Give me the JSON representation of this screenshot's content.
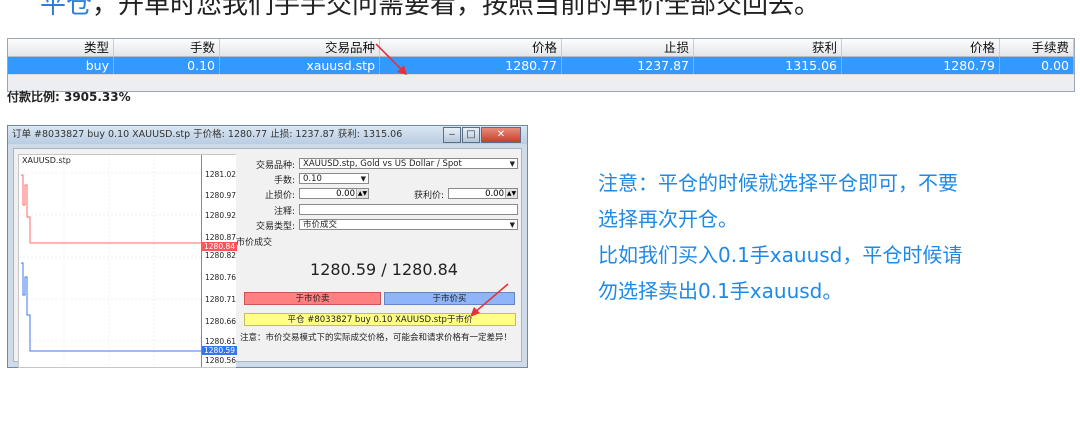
{
  "header_cut_text": {
    "prefix": "平仓",
    "rest": "，开单时您我们手手交问需要看，按照当前的单价全部交回去。"
  },
  "trade_table": {
    "columns": [
      "类型",
      "手数",
      "交易品种",
      "价格",
      "止损",
      "获利",
      "价格",
      "手续费"
    ],
    "rows": [
      [
        "buy",
        "0.10",
        "xauusd.stp",
        "1280.77",
        "1237.87",
        "1315.06",
        "1280.79",
        "0.00"
      ]
    ],
    "margin_ratio_label": "付款比例: 3905.33%"
  },
  "dialog": {
    "title": "订单 #8033827 buy 0.10 XAUUSD.stp 于价格: 1280.77 止损: 1237.87 获利: 1315.06",
    "chart": {
      "symbol": "XAUUSD.stp",
      "price_labels": [
        "1281.02",
        "1280.97",
        "1280.92",
        "1280.87",
        "1280.84",
        "1280.82",
        "1280.76",
        "1280.71",
        "1280.66",
        "1280.61",
        "1280.59",
        "1280.56"
      ],
      "ask_highlight": "1280.84",
      "bid_highlight": "1280.59"
    },
    "form": {
      "symbol_label": "交易品种:",
      "symbol_value": "XAUUSD.stp, Gold vs US Dollar / Spot",
      "volume_label": "手数:",
      "volume_value": "0.10",
      "sl_label": "止损价:",
      "sl_value": "0.00",
      "tp_label": "获利价:",
      "tp_value": "0.00",
      "comment_label": "注释:",
      "comment_value": "",
      "type_label": "交易类型:",
      "type_value": "市价成交",
      "section_label": "市价成交"
    },
    "quote": "1280.59 / 1280.84",
    "sell_button": "于市价卖",
    "buy_button": "于市价买",
    "close_button": "平仓 #8033827 buy 0.10 XAUUSD.stp于市价",
    "disclaimer": "注意：市价交易模式下的实际成交价格，可能会和请求价格有一定差异！"
  },
  "note": {
    "line1": "注意：平仓的时候就选择平仓即可，不要",
    "line2": "选择再次开仓。",
    "line3": "比如我们买入0.1手xauusd，平仓时候请",
    "line4": "勿选择卖出0.1手xauusd。"
  },
  "colors": {
    "accent_blue": "#1f8ae6",
    "row_select": "#3399ff",
    "sell": "#ff8080",
    "buy": "#8fb4f7",
    "close": "#ffff88",
    "arrow": "#e8303a"
  }
}
